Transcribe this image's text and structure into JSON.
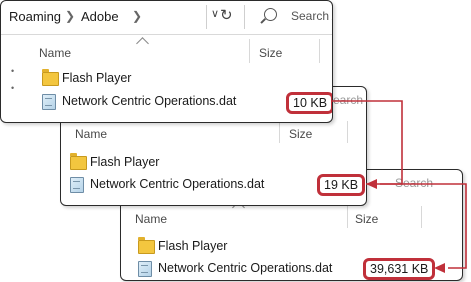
{
  "window1": {
    "breadcrumb": [
      "Roaming",
      "Adobe"
    ],
    "search_placeholder": "Search A",
    "columns": {
      "name": "Name",
      "size": "Size"
    },
    "files": [
      {
        "name": "Flash Player",
        "type": "folder"
      },
      {
        "name": "Network Centric Operations.dat",
        "type": "dat",
        "size": "10 KB"
      }
    ]
  },
  "window2": {
    "search_placeholder": "Search",
    "columns": {
      "name": "Name",
      "size": "Size"
    },
    "files": [
      {
        "name": "Flash Player",
        "type": "folder"
      },
      {
        "name": "Network Centric Operations.dat",
        "type": "dat",
        "size": "19 KB"
      }
    ]
  },
  "window3": {
    "columns": {
      "name": "Name",
      "size": "Size"
    },
    "files": [
      {
        "name": "Flash Player",
        "type": "folder"
      },
      {
        "name": "Network Centric Operations.dat",
        "type": "dat",
        "size": "39,631 KB"
      }
    ]
  },
  "colors": {
    "highlight": "#c0303a",
    "folder": "#f3c63f",
    "border": "#2b2b2b"
  },
  "icons": [
    "chevron-right-icon",
    "chevron-down-icon",
    "refresh-icon",
    "search-icon",
    "folder-icon",
    "dat-file-icon",
    "sort-up-icon"
  ]
}
